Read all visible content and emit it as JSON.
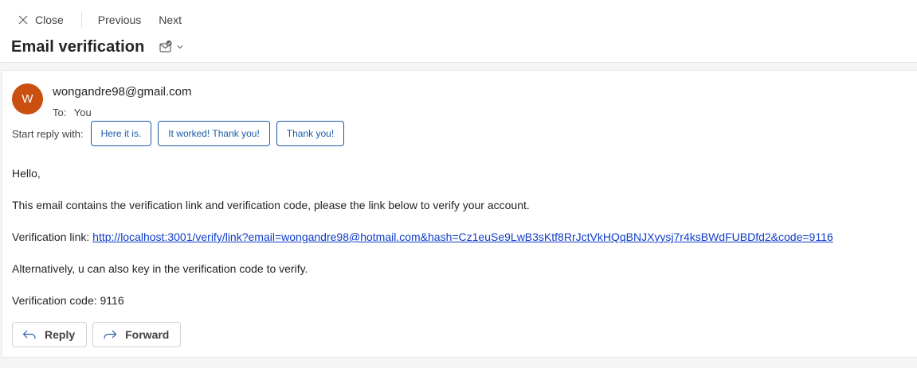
{
  "toolbar": {
    "close_label": "Close",
    "previous_label": "Previous",
    "next_label": "Next"
  },
  "subject": "Email verification",
  "message": {
    "avatar_initial": "W",
    "avatar_color": "#ca5010",
    "sender": "wongandre98@gmail.com",
    "to_label": "To:",
    "to_value": "You",
    "start_reply_label": "Start reply with:",
    "suggested_replies": [
      "Here it is.",
      "It worked! Thank you!",
      "Thank you!"
    ],
    "greeting": "Hello,",
    "paragraph1": "This email contains the verification link and verification code, please the link below to verify your account.",
    "link_label": "Verification link: ",
    "link_text": "http://localhost:3001/verify/link?email=wongandre98@hotmail.com&hash=Cz1euSe9LwB3sKtf8RrJctVkHQqBNJXyysj7r4ksBWdFUBDfd2&code=9116",
    "paragraph3": "Alternatively, u can also key in the verification code to verify.",
    "code_line": "Verification code: 9116"
  },
  "actions": {
    "reply_label": "Reply",
    "forward_label": "Forward"
  },
  "colors": {
    "accent": "#1b5aa8",
    "link": "#0f3cc9"
  }
}
